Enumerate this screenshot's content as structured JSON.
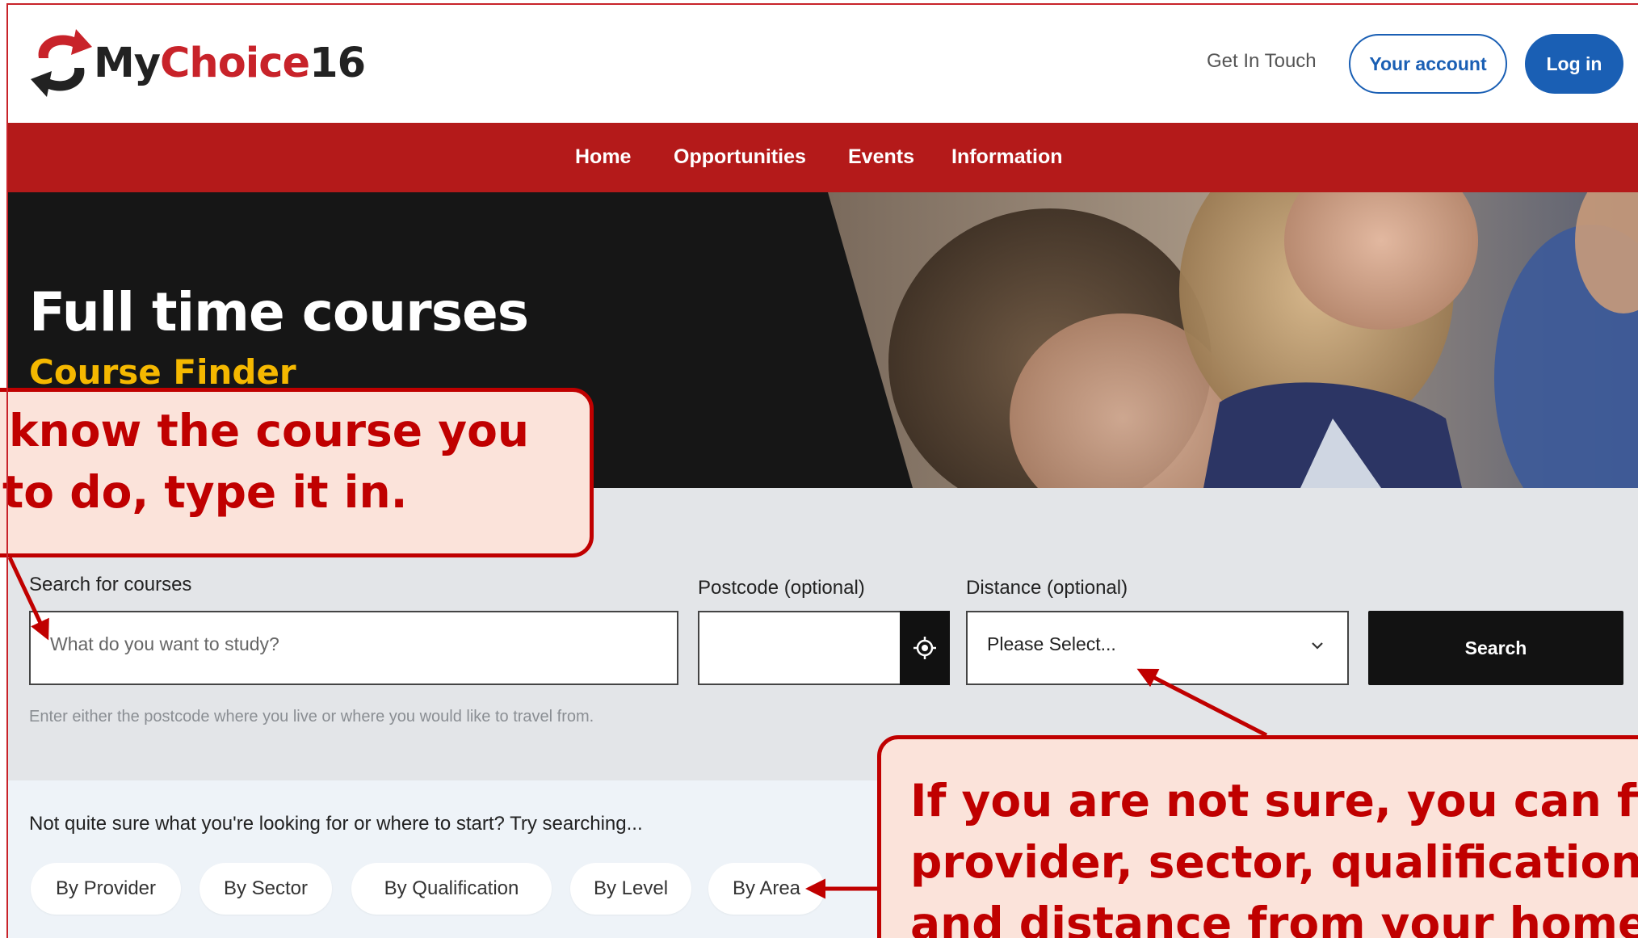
{
  "header": {
    "logo": {
      "text_my": "My",
      "text_choice": "Choice",
      "text_num": "16"
    },
    "get_in_touch": "Get In Touch",
    "your_account": "Your account",
    "log_in": "Log in"
  },
  "nav": {
    "items": [
      {
        "label": "Home"
      },
      {
        "label": "Opportunities"
      },
      {
        "label": "Events"
      },
      {
        "label": "Information"
      }
    ]
  },
  "hero": {
    "title": "Full time courses",
    "subtitle": "Course Finder"
  },
  "search": {
    "course_label": "Search for courses",
    "course_placeholder": "What do you want to study?",
    "postcode_label": "Postcode (optional)",
    "postcode_value": "",
    "distance_label": "Distance (optional)",
    "distance_selected": "Please Select...",
    "search_button": "Search",
    "hint": "Enter either the postcode where you live or where you would like to travel from."
  },
  "explore": {
    "prompt": "Not quite sure what you're looking for or where to start? Try searching...",
    "pills": [
      {
        "label": "By Provider"
      },
      {
        "label": "By Sector"
      },
      {
        "label": "By Qualification"
      },
      {
        "label": "By Level"
      },
      {
        "label": "By Area"
      }
    ]
  },
  "callouts": {
    "left": {
      "line1": "know the course you",
      "line2": "to do, type it in."
    },
    "right": {
      "line1": "If you are not sure, you can filter b",
      "line2": "provider, sector, qualification, leve",
      "line3": "and distance from your home"
    }
  },
  "colors": {
    "brand_red": "#b41a1a",
    "accent_blue": "#1a5fb4",
    "hero_yellow": "#f5b800",
    "callout_red": "#c00000",
    "callout_fill": "#fbe3da"
  }
}
